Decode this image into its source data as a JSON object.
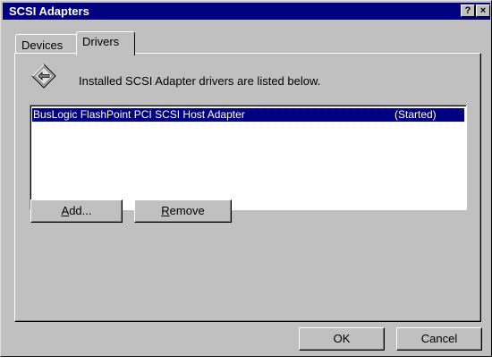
{
  "window": {
    "title": "SCSI Adapters",
    "help_label": "?",
    "close_label": "×"
  },
  "tabs": [
    {
      "label": "Devices",
      "active": false
    },
    {
      "label": "Drivers",
      "active": true
    }
  ],
  "drivers_panel": {
    "header_text": "Installed SCSI Adapter drivers are listed below.",
    "icon": "scsi-adapter-icon",
    "drivers": [
      {
        "name": "BusLogic FlashPoint PCI SCSI Host Adapter",
        "status": "(Started)",
        "selected": true
      }
    ],
    "add_button": {
      "mnemonic": "A",
      "rest": "dd..."
    },
    "remove_button": {
      "mnemonic": "R",
      "rest": "emove"
    }
  },
  "footer": {
    "ok_label": "OK",
    "cancel_label": "Cancel"
  },
  "colors": {
    "titlebar": "#000080",
    "face": "#c0c0c0",
    "selection": "#000080"
  }
}
